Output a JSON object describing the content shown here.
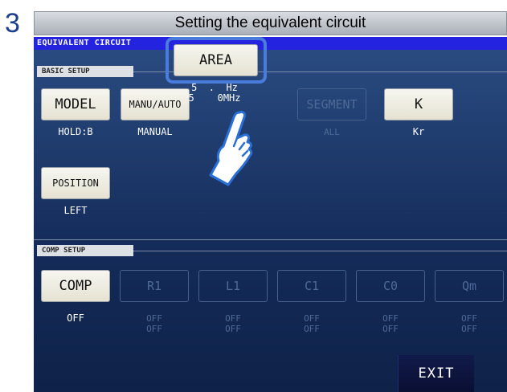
{
  "step": {
    "number": "3",
    "caption": "Setting the equivalent circuit"
  },
  "screen": {
    "title": "EQUIVALENT CIRCUIT",
    "basic_setup": {
      "label": "BASIC SETUP",
      "model": {
        "label": "MODEL",
        "value": "HOLD:B"
      },
      "manu_auto": {
        "label": "MANU/AUTO",
        "value": "MANUAL"
      },
      "area": {
        "label": "AREA",
        "value_line1": "5  .  Hz",
        "value_line2": "5    0MHz"
      },
      "segment": {
        "label": "SEGMENT",
        "value": "ALL"
      },
      "k": {
        "label": "K",
        "value": "Kr"
      },
      "position": {
        "label": "POSITION",
        "value": "LEFT"
      }
    },
    "comp_setup": {
      "label": "COMP SETUP",
      "comp": {
        "label": "COMP",
        "value": "OFF"
      },
      "params": [
        {
          "label": "R1",
          "value": "OFF\nOFF"
        },
        {
          "label": "L1",
          "value": "OFF\nOFF"
        },
        {
          "label": "C1",
          "value": "OFF\nOFF"
        },
        {
          "label": "C0",
          "value": "OFF\nOFF"
        },
        {
          "label": "Qm",
          "value": "OFF\nOFF"
        }
      ]
    },
    "exit_label": "EXIT"
  },
  "colors": {
    "title_bar": "#2323e0",
    "highlight": "#4a7ddb",
    "screen_bg": "#142b59"
  }
}
